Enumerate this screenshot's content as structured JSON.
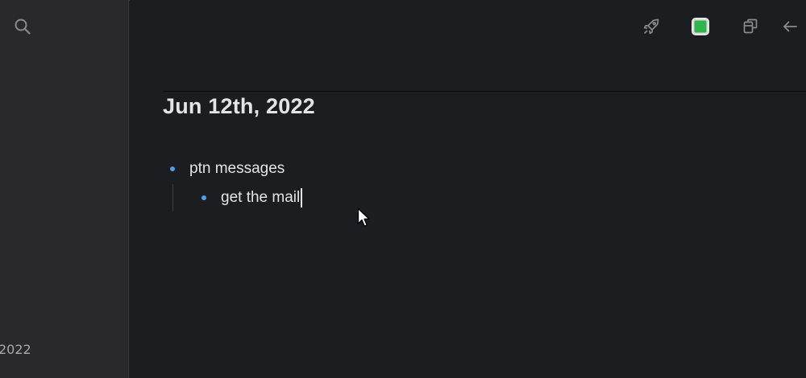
{
  "sidebar": {
    "search_icon": "search-icon",
    "footer_text": "2022"
  },
  "toolbar": {
    "icons": [
      "rocket-icon",
      "color-swatch",
      "copy-window-icon",
      "arrow-left-icon"
    ],
    "swatch_color": "#31b54b"
  },
  "page": {
    "title": "Jun 12th, 2022",
    "blocks": [
      {
        "text": "ptn messages",
        "level": 0
      },
      {
        "text": "get the mail",
        "level": 1
      }
    ]
  },
  "colors": {
    "background": "#1c1d20",
    "sidebar": "#29292c",
    "bullet": "#4da0ef",
    "text": "#e4e4e6"
  }
}
